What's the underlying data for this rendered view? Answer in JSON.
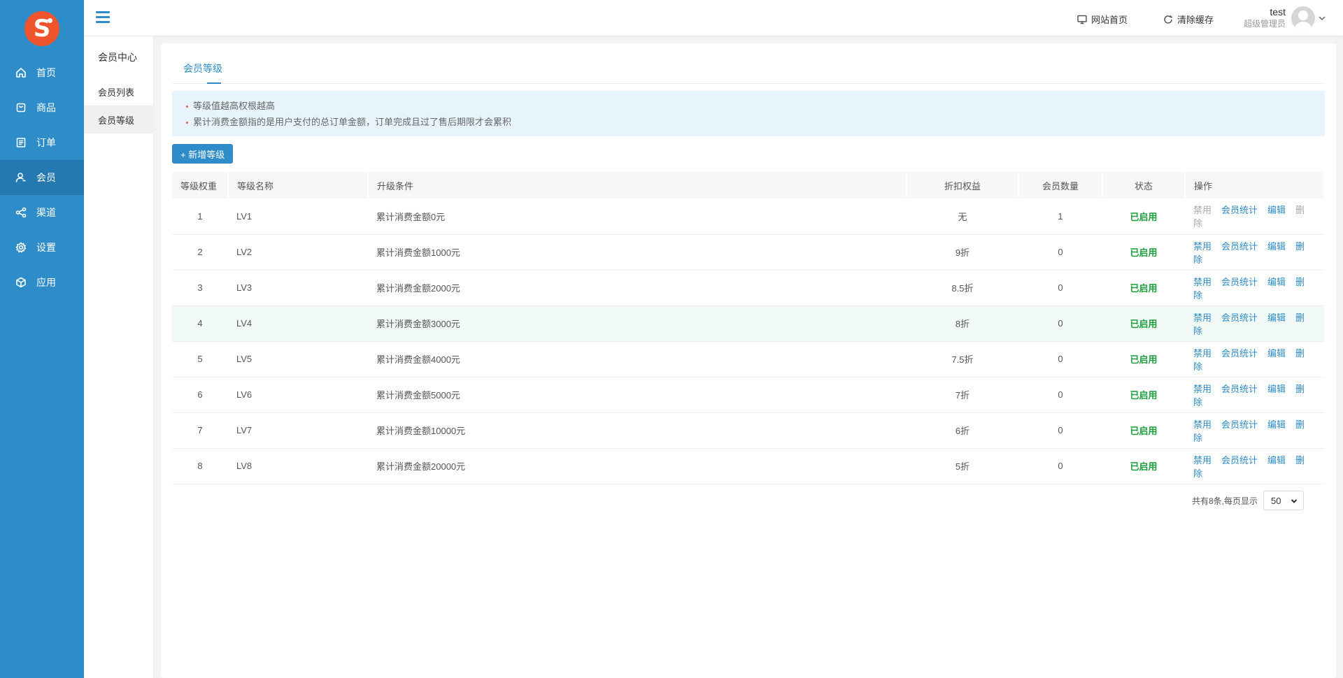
{
  "nav": {
    "items": [
      {
        "label": "首页",
        "icon": "home-icon"
      },
      {
        "label": "商品",
        "icon": "bag-icon"
      },
      {
        "label": "订单",
        "icon": "list-icon"
      },
      {
        "label": "会员",
        "icon": "user-icon"
      },
      {
        "label": "渠道",
        "icon": "share-icon"
      },
      {
        "label": "设置",
        "icon": "gear-icon"
      },
      {
        "label": "应用",
        "icon": "cube-icon"
      }
    ]
  },
  "submenu": {
    "title": "会员中心",
    "items": [
      "会员列表",
      "会员等级"
    ]
  },
  "topbar": {
    "site_home": "网站首页",
    "clear_cache": "清除缓存",
    "user_name": "test",
    "user_role": "超级管理员"
  },
  "page": {
    "tab": "会员等级",
    "notice": [
      "等级值越高权根越高",
      "累计消费金额指的是用户支付的总订单金额，订单完成且过了售后期限才会累积"
    ],
    "add_button": "+ 新增等级"
  },
  "table": {
    "headers": [
      "等级权重",
      "等级名称",
      "升级条件",
      "折扣权益",
      "会员数量",
      "状态",
      "操作"
    ],
    "rows": [
      {
        "weight": "1",
        "name": "LV1",
        "cond": "累计消费金额0元",
        "discount": "无",
        "count": "1",
        "status": "已启用"
      },
      {
        "weight": "2",
        "name": "LV2",
        "cond": "累计消费金额1000元",
        "discount": "9折",
        "count": "0",
        "status": "已启用"
      },
      {
        "weight": "3",
        "name": "LV3",
        "cond": "累计消费金额2000元",
        "discount": "8.5折",
        "count": "0",
        "status": "已启用"
      },
      {
        "weight": "4",
        "name": "LV4",
        "cond": "累计消费金额3000元",
        "discount": "8折",
        "count": "0",
        "status": "已启用"
      },
      {
        "weight": "5",
        "name": "LV5",
        "cond": "累计消费金额4000元",
        "discount": "7.5折",
        "count": "0",
        "status": "已启用"
      },
      {
        "weight": "6",
        "name": "LV6",
        "cond": "累计消费金额5000元",
        "discount": "7折",
        "count": "0",
        "status": "已启用"
      },
      {
        "weight": "7",
        "name": "LV7",
        "cond": "累计消费金额10000元",
        "discount": "6折",
        "count": "0",
        "status": "已启用"
      },
      {
        "weight": "8",
        "name": "LV8",
        "cond": "累计消费金额20000元",
        "discount": "5折",
        "count": "0",
        "status": "已启用"
      }
    ],
    "actions": {
      "disable": "禁用",
      "stats": "会员统计",
      "edit": "编辑",
      "delete": "删除"
    }
  },
  "pager": {
    "summary": "共有8条,每页显示",
    "per_page": "50"
  },
  "colors": {
    "primary": "#2e8cc8",
    "nav_active": "#2479b0",
    "logo": "#f0542d",
    "status_on": "#1a9d3a"
  }
}
